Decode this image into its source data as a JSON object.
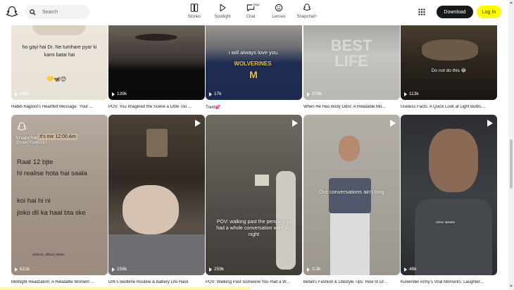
{
  "header": {
    "search_placeholder": "Search",
    "nav": [
      {
        "label": "Stories",
        "icon": "stories-icon"
      },
      {
        "label": "Spotlight",
        "icon": "spotlight-icon"
      },
      {
        "label": "Chat",
        "icon": "chat-icon",
        "badge": "New"
      },
      {
        "label": "Lenses",
        "icon": "lenses-icon"
      },
      {
        "label": "Snapchat+",
        "icon": "snapchat-plus-icon"
      }
    ],
    "download_label": "Download",
    "login_label": "Log In"
  },
  "colors": {
    "accent": "#fffc00",
    "dark": "#16191c"
  },
  "row1": [
    {
      "views": "439k",
      "title": "Habib Rajpoot's Heartfelt Message: 'Your ...",
      "overlay": "ho gayi hai Dr. Ne tumhare pyar ki kami batai hai"
    },
    {
      "views": "139k",
      "title": "POV: You Imagined the Scene a Little Too ..."
    },
    {
      "views": "17k",
      "title": "Trent💕",
      "overlay": "i will always love you."
    },
    {
      "views": "378k",
      "title": "When He Has Body Odor: A Relatable Mo..."
    },
    {
      "views": "113k",
      "title": "Useless Facts: A Quick Look at Light Bulbs,...",
      "overlay": "Do not do this 😂"
    }
  ],
  "row2": [
    {
      "views": "621k",
      "title": "Midnight Realization: A Relatable Moment ...",
      "brand": "Snapchat",
      "user": "@user70140310",
      "time_text": "It's me 12:00 Am",
      "line1": "Raat 12 bjte",
      "line2": "hi realise hota hai saala",
      "line3": "koi hai hi ni",
      "line4": "jisko dil ka haal bta ske",
      "credit": "@shruti_official_5845s"
    },
    {
      "views": "156k",
      "title": "DrK's Bedtime Routine & Battery Life Hack"
    },
    {
      "views": "259k",
      "title": "POV: Walking Past Someone You Had a W...",
      "overlay": "POV: walking past the person you had a whole conversation with last night"
    },
    {
      "views": "3.3k",
      "title": "Betali's Fashion & Lifestyle Tips: How to Dr...",
      "overlay": "Our conversations ain't long"
    },
    {
      "views": "46k",
      "title": "Kulwinder Army's Viral Moments: Laughter...",
      "overlay": "rainer speaks"
    }
  ]
}
